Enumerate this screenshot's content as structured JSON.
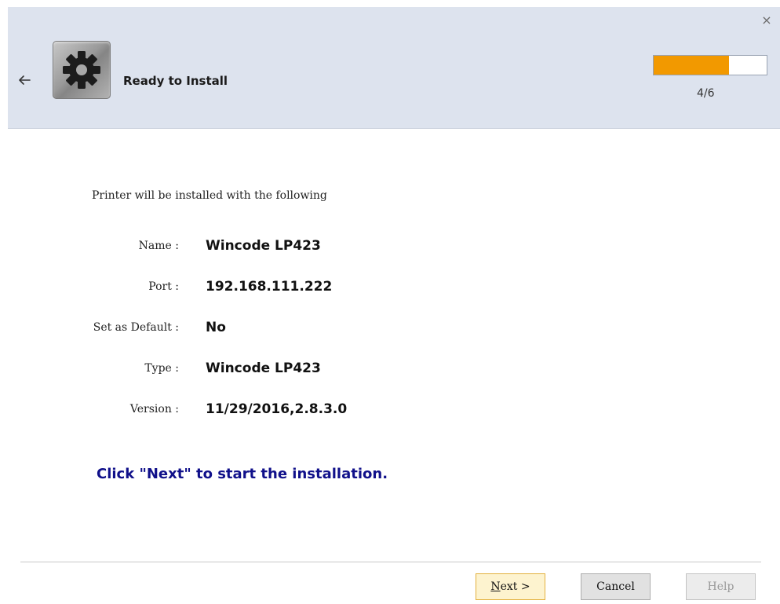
{
  "window": {
    "close_label": "×"
  },
  "header": {
    "title": "Ready to Install",
    "step": "4/6",
    "progress": 0.667,
    "progress_color": "#f29900",
    "icon": "gear-icon",
    "back_icon": "arrow-left-icon"
  },
  "content": {
    "intro": "Printer will be installed with the following",
    "rows": [
      {
        "label": "Name :",
        "value": "Wincode LP423"
      },
      {
        "label": "Port :",
        "value": "192.168.111.222"
      },
      {
        "label": "Set as Default :",
        "value": "No"
      },
      {
        "label": "Type :",
        "value": "Wincode LP423"
      },
      {
        "label": "Version :",
        "value": "11/29/2016,2.8.3.0"
      }
    ],
    "instruction": "Click \"Next\" to start the installation.",
    "instruction_color": "#10108a"
  },
  "footer": {
    "next_label": "Next >",
    "cancel_label": "Cancel",
    "help_label": "Help"
  }
}
